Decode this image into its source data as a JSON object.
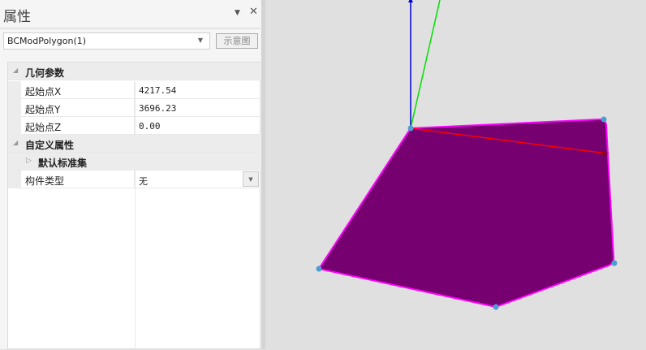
{
  "panel": {
    "title": "属性",
    "object_select": "BCModPolygon(1)",
    "diagram_button": "示意图"
  },
  "grid": {
    "cat1": "几何参数",
    "props1": [
      {
        "name": "起始点X",
        "value": "4217.54"
      },
      {
        "name": "起始点Y",
        "value": "3696.23"
      },
      {
        "name": "起始点Z",
        "value": "0.00"
      }
    ],
    "cat2": "自定义属性",
    "sub": "默认标准集",
    "props2": [
      {
        "name": "构件类型",
        "value": "无"
      }
    ]
  },
  "colors": {
    "fill": "#770070",
    "edge": "#ff00ff",
    "vertex": "#4a9fd0",
    "x_axis": "#ff0000",
    "y_axis": "#00e000",
    "z_axis": "#0000d0"
  }
}
